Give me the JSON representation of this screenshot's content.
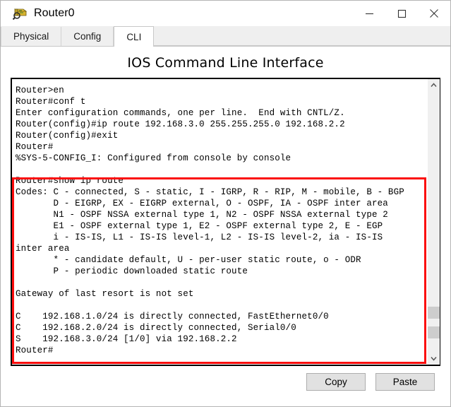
{
  "window": {
    "title": "Router0",
    "icon": "router-device-icon",
    "controls": {
      "minimize": "minimize-icon",
      "maximize": "maximize-icon",
      "close": "close-icon"
    }
  },
  "tabs": [
    {
      "label": "Physical",
      "active": false
    },
    {
      "label": "Config",
      "active": false
    },
    {
      "label": "CLI",
      "active": true
    }
  ],
  "heading": "IOS Command Line Interface",
  "terminal": {
    "lines_before": [
      "Router>en",
      "Router#conf t",
      "Enter configuration commands, one per line.  End with CNTL/Z.",
      "Router(config)#ip route 192.168.3.0 255.255.255.0 192.168.2.2",
      "Router(config)#exit",
      "Router#",
      "%SYS-5-CONFIG_I: Configured from console by console",
      ""
    ],
    "lines_highlighted": [
      "Router#show ip route",
      "Codes: C - connected, S - static, I - IGRP, R - RIP, M - mobile, B - BGP",
      "       D - EIGRP, EX - EIGRP external, O - OSPF, IA - OSPF inter area",
      "       N1 - OSPF NSSA external type 1, N2 - OSPF NSSA external type 2",
      "       E1 - OSPF external type 1, E2 - OSPF external type 2, E - EGP",
      "       i - IS-IS, L1 - IS-IS level-1, L2 - IS-IS level-2, ia - IS-IS",
      "inter area",
      "       * - candidate default, U - per-user static route, o - ODR",
      "       P - periodic downloaded static route",
      "",
      "Gateway of last resort is not set",
      "",
      "C    192.168.1.0/24 is directly connected, FastEthernet0/0",
      "C    192.168.2.0/24 is directly connected, Serial0/0",
      "S    192.168.3.0/24 [1/0] via 192.168.2.2",
      "Router#"
    ],
    "highlight_color": "#fb0d0d",
    "scrollbar": {
      "up_arrow": "chevron-up-icon",
      "down_arrow": "chevron-down-icon"
    }
  },
  "footer": {
    "copy_label": "Copy",
    "paste_label": "Paste"
  }
}
